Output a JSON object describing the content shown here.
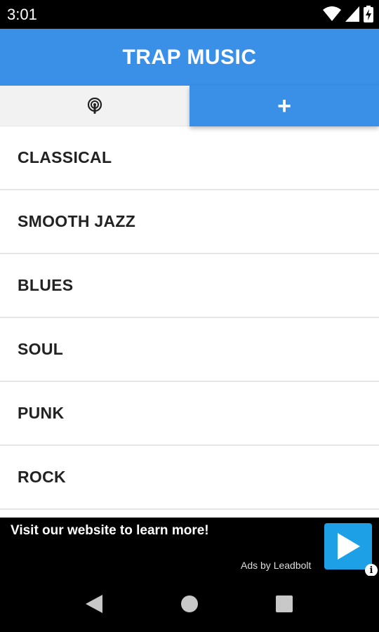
{
  "status_bar": {
    "time": "3:01",
    "icons": [
      "wifi-icon",
      "cell-signal-icon",
      "battery-charging-icon"
    ]
  },
  "app_bar": {
    "title": "TRAP MUSIC"
  },
  "tabs": [
    {
      "icon": "podcast-icon",
      "selected": false
    },
    {
      "icon": "plus-icon",
      "label": "+",
      "selected": true
    }
  ],
  "genres": [
    "CLASSICAL",
    "SMOOTH JAZZ",
    "BLUES",
    "SOUL",
    "PUNK",
    "ROCK"
  ],
  "ad": {
    "headline": "Visit our website to learn more!",
    "attribution": "Ads by Leadbolt",
    "info_label": "i",
    "button_icon": "play-icon"
  },
  "nav_bar": {
    "icons": [
      "back-icon",
      "home-icon",
      "recents-icon"
    ]
  },
  "colors": {
    "accent": "#3a8fe6",
    "ad_button": "#1ea0e6"
  }
}
